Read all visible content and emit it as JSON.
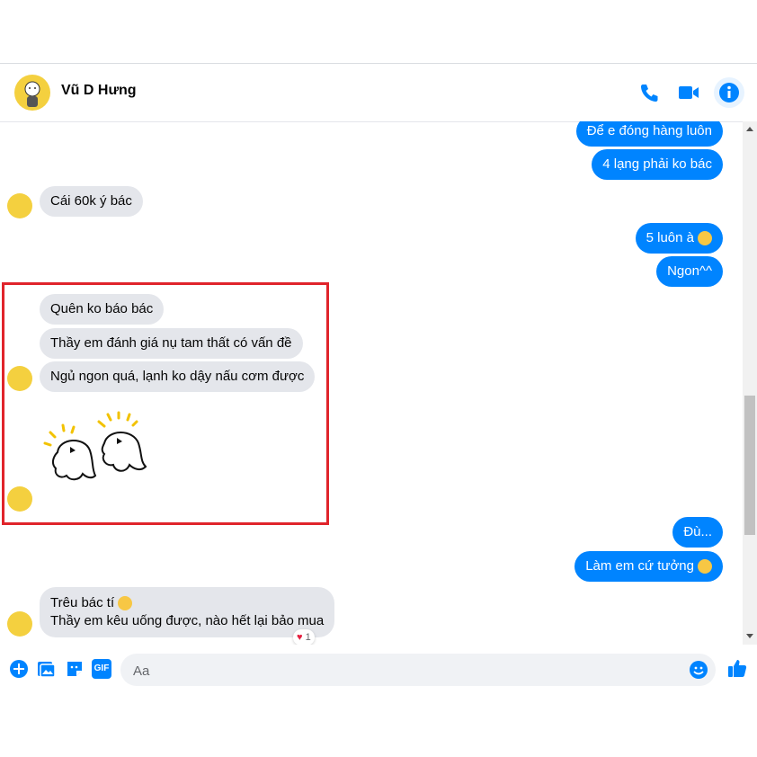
{
  "contact": {
    "name": "Vũ D Hưng"
  },
  "header_icons": [
    "phone-icon",
    "video-camera-icon",
    "info-icon"
  ],
  "messages": {
    "out1": "Để e đóng hàng luôn",
    "out2": "4 lạng phải ko bác",
    "in1": "Cái 60k ý bác",
    "out3": "5 luôn à",
    "out4": "Ngon^^",
    "in2": "Quên ko báo bác",
    "in3": "Thầy em đánh giá nụ tam thất có vấn đề",
    "in4": "Ngủ ngon quá, lạnh ko dậy nấu cơm được",
    "out5": "Đù...",
    "out6": "Làm em cứ tưởng",
    "in5_line1": "Trêu bác tí",
    "in5_line2": "Thầy em kêu uống được, nào hết lại bảo mua",
    "reaction_count": "1"
  },
  "composer": {
    "placeholder": "Aa",
    "icons": [
      "plus-icon",
      "image-icon",
      "sticker-icon",
      "gif-icon",
      "emoji-icon",
      "like-icon"
    ],
    "gif_label": "GIF"
  },
  "colors": {
    "accent": "#0084ff",
    "incoming": "#e4e6eb",
    "highlight": "#e0242b",
    "avatar": "#f4d03f"
  }
}
